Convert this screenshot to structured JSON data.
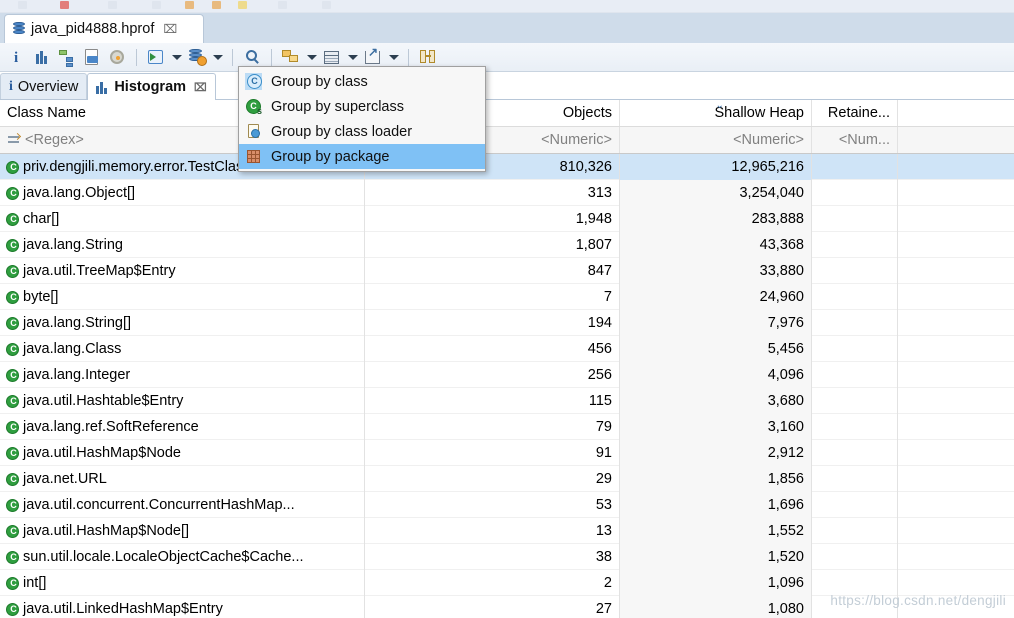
{
  "window": {
    "editor_tab": {
      "title": "java_pid4888.hprof",
      "close_glyph": "⌧",
      "icon": "heap-dump-icon"
    }
  },
  "toolbar": {
    "items": [
      {
        "name": "info-icon",
        "label": "Overview information"
      },
      {
        "name": "histogram-icon",
        "label": "Histogram"
      },
      {
        "name": "dominator-tree-icon",
        "label": "Dominator Tree"
      },
      {
        "name": "oql-icon",
        "label": "OQL"
      },
      {
        "name": "inspector-icon",
        "label": "Thread Overview"
      },
      {
        "name": "run-query-icon",
        "label": "Run Expert System Test"
      },
      {
        "name": "heap-actions-icon",
        "label": "Queries"
      },
      {
        "name": "find-icon",
        "label": "Find"
      },
      {
        "name": "group-by-icon",
        "label": "Group result by"
      },
      {
        "name": "calculator-icon",
        "label": "Calculate retained size"
      },
      {
        "name": "export-icon",
        "label": "Export"
      },
      {
        "name": "compare-icon",
        "label": "Compare to another heap dump"
      }
    ]
  },
  "view_tabs": [
    {
      "label": "Overview",
      "icon": "info-icon",
      "active": false,
      "closable": false
    },
    {
      "label": "Histogram",
      "icon": "histogram-icon",
      "active": true,
      "closable": true,
      "close_glyph": "⌧"
    }
  ],
  "menu": {
    "items": [
      {
        "label": "Group by class",
        "icon": "group-by-class-icon",
        "highlighted": false
      },
      {
        "label": "Group by superclass",
        "icon": "group-by-superclass-icon",
        "highlighted": false
      },
      {
        "label": "Group by class loader",
        "icon": "group-by-class-loader-icon",
        "highlighted": false
      },
      {
        "label": "Group by package",
        "icon": "group-by-package-icon",
        "highlighted": true
      }
    ]
  },
  "table": {
    "columns": [
      {
        "key": "name",
        "label": "Class Name",
        "filter": "<Regex>",
        "align": "left",
        "sorted": false
      },
      {
        "key": "objects",
        "label": "Objects",
        "filter": "<Numeric>",
        "align": "right",
        "sorted": false
      },
      {
        "key": "shallow",
        "label": "Shallow Heap",
        "filter": "<Numeric>",
        "align": "right",
        "sorted": true,
        "sort_dir": "desc",
        "sort_glyph": "⌄"
      },
      {
        "key": "retained",
        "label": "Retaine...",
        "filter": "<Num...",
        "align": "right",
        "sorted": false
      }
    ],
    "rows": [
      {
        "name": "priv.dengjili.memory.error.TestClass",
        "objects": "810,326",
        "shallow": "12,965,216",
        "retained": "",
        "selected": true
      },
      {
        "name": "java.lang.Object[]",
        "objects": "313",
        "shallow": "3,254,040",
        "retained": "",
        "selected": false
      },
      {
        "name": "char[]",
        "objects": "1,948",
        "shallow": "283,888",
        "retained": "",
        "selected": false
      },
      {
        "name": "java.lang.String",
        "objects": "1,807",
        "shallow": "43,368",
        "retained": "",
        "selected": false
      },
      {
        "name": "java.util.TreeMap$Entry",
        "objects": "847",
        "shallow": "33,880",
        "retained": "",
        "selected": false
      },
      {
        "name": "byte[]",
        "objects": "7",
        "shallow": "24,960",
        "retained": "",
        "selected": false
      },
      {
        "name": "java.lang.String[]",
        "objects": "194",
        "shallow": "7,976",
        "retained": "",
        "selected": false
      },
      {
        "name": "java.lang.Class",
        "objects": "456",
        "shallow": "5,456",
        "retained": "",
        "selected": false
      },
      {
        "name": "java.lang.Integer",
        "objects": "256",
        "shallow": "4,096",
        "retained": "",
        "selected": false
      },
      {
        "name": "java.util.Hashtable$Entry",
        "objects": "115",
        "shallow": "3,680",
        "retained": "",
        "selected": false
      },
      {
        "name": "java.lang.ref.SoftReference",
        "objects": "79",
        "shallow": "3,160",
        "retained": "",
        "selected": false
      },
      {
        "name": "java.util.HashMap$Node",
        "objects": "91",
        "shallow": "2,912",
        "retained": "",
        "selected": false
      },
      {
        "name": "java.net.URL",
        "objects": "29",
        "shallow": "1,856",
        "retained": "",
        "selected": false
      },
      {
        "name": "java.util.concurrent.ConcurrentHashMap...",
        "objects": "53",
        "shallow": "1,696",
        "retained": "",
        "selected": false
      },
      {
        "name": "java.util.HashMap$Node[]",
        "objects": "13",
        "shallow": "1,552",
        "retained": "",
        "selected": false
      },
      {
        "name": "sun.util.locale.LocaleObjectCache$Cache...",
        "objects": "38",
        "shallow": "1,520",
        "retained": "",
        "selected": false
      },
      {
        "name": "int[]",
        "objects": "2",
        "shallow": "1,096",
        "retained": "",
        "selected": false
      },
      {
        "name": "java.util.LinkedHashMap$Entry",
        "objects": "27",
        "shallow": "1,080",
        "retained": "",
        "selected": false
      }
    ]
  },
  "watermark": {
    "text": "https://blog.csdn.net/dengjili"
  },
  "colors": {
    "selection": "#cfe4f7",
    "menu_highlight": "#7fc1f5",
    "tabbar": "#cfdcea",
    "class_icon": "#2f9e3f"
  }
}
